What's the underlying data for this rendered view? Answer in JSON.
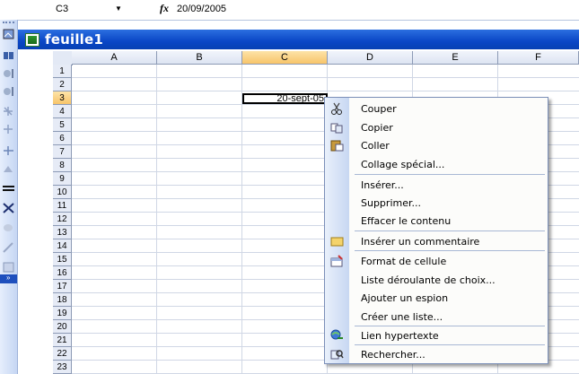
{
  "formula_bar": {
    "name_box": "C3",
    "fx_symbol": "fx",
    "value": "20/09/2005"
  },
  "window": {
    "title": "feuille1"
  },
  "columns": [
    "A",
    "B",
    "C",
    "D",
    "E",
    "F"
  ],
  "rows": [
    "1",
    "2",
    "3",
    "4",
    "5",
    "6",
    "7",
    "8",
    "9",
    "10",
    "11",
    "12",
    "13",
    "14",
    "15",
    "16",
    "17",
    "18",
    "19",
    "20",
    "21",
    "22",
    "23"
  ],
  "cell_c3": "20-sept-05",
  "context_menu": {
    "items": [
      {
        "label": "Couper",
        "icon": "scissors-icon"
      },
      {
        "label": "Copier",
        "icon": "copy-icon"
      },
      {
        "label": "Coller",
        "icon": "paste-icon"
      },
      {
        "label": "Collage spécial...",
        "icon": ""
      },
      {
        "label": "Insérer...",
        "icon": ""
      },
      {
        "label": "Supprimer...",
        "icon": ""
      },
      {
        "label": "Effacer le contenu",
        "icon": ""
      },
      {
        "label": "Insérer un commentaire",
        "icon": "comment-icon"
      },
      {
        "label": "Format de cellule",
        "icon": "format-cells-icon"
      },
      {
        "label": "Liste déroulante de choix...",
        "icon": ""
      },
      {
        "label": "Ajouter un espion",
        "icon": ""
      },
      {
        "label": "Créer une liste...",
        "icon": ""
      },
      {
        "label": "Lien hypertexte",
        "icon": "hyperlink-icon"
      },
      {
        "label": "Rechercher...",
        "icon": "research-icon"
      }
    ]
  }
}
